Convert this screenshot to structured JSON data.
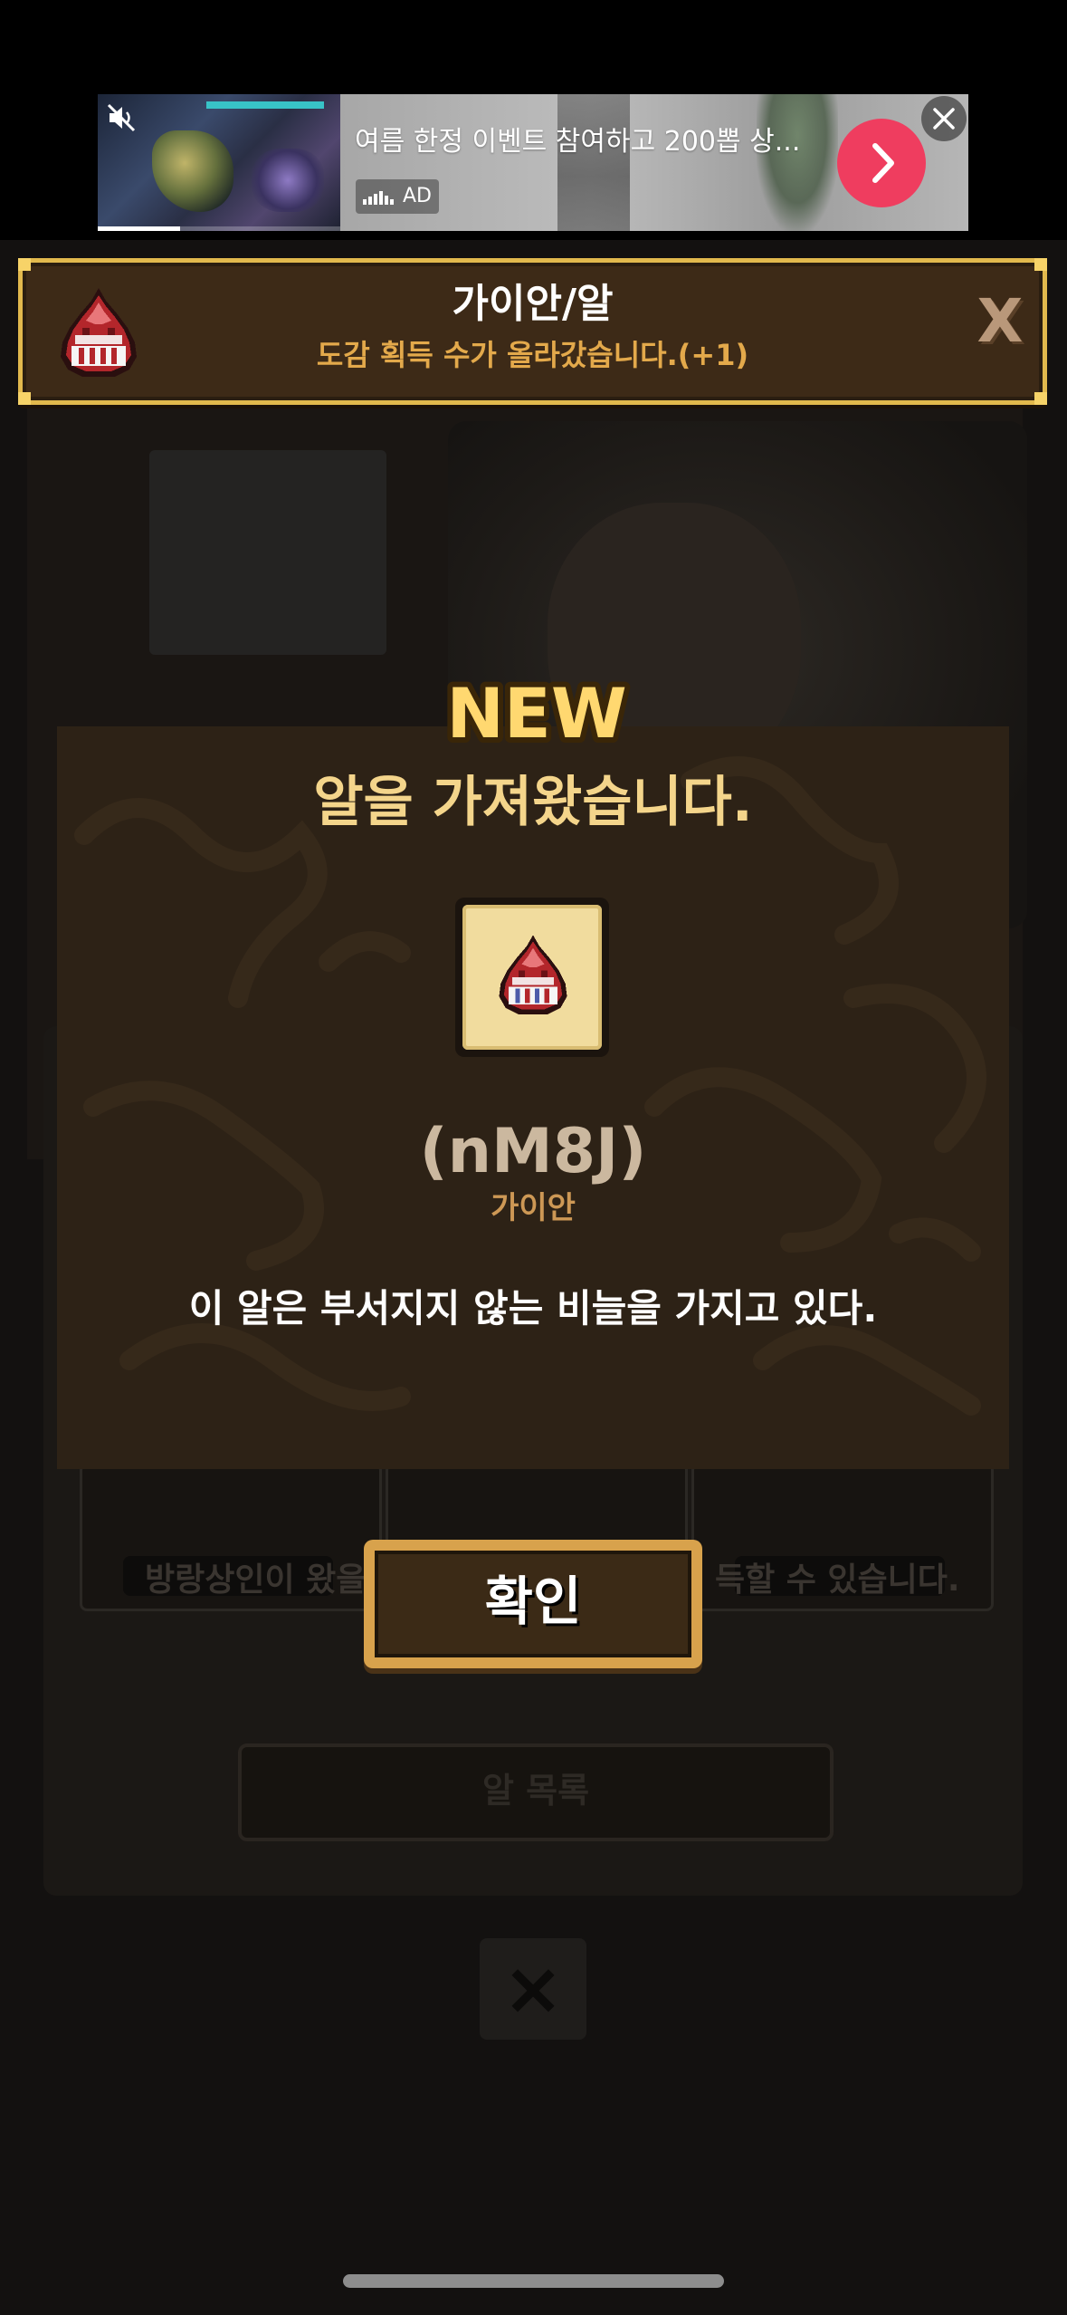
{
  "ad": {
    "headline": "여름 한정 이벤트 참여하고 200뽑 상...",
    "badge": "AD",
    "video_progress": 0.34,
    "arrow_color": "#ef3d5f"
  },
  "notification": {
    "title": "가이안/알",
    "subtitle": "도감 획득 수가 올라갔습니다.(+1)",
    "close_label": "X",
    "border_color": "#e2b94d"
  },
  "background": {
    "merchant_message": "방랑상인이 왔을",
    "merchant_message_end": "득할 수 있습니다.",
    "list_button_label": "알 목록",
    "close_icon": "×"
  },
  "modal": {
    "badge": "NEW",
    "title": "알을 가져왔습니다.",
    "item_name": "(nM8J)",
    "item_type": "가이안",
    "description": "이 알은 부서지지 않는 비늘을 가지고 있다.",
    "title_color": "#f4d58b"
  },
  "confirm": {
    "label": "확인"
  }
}
